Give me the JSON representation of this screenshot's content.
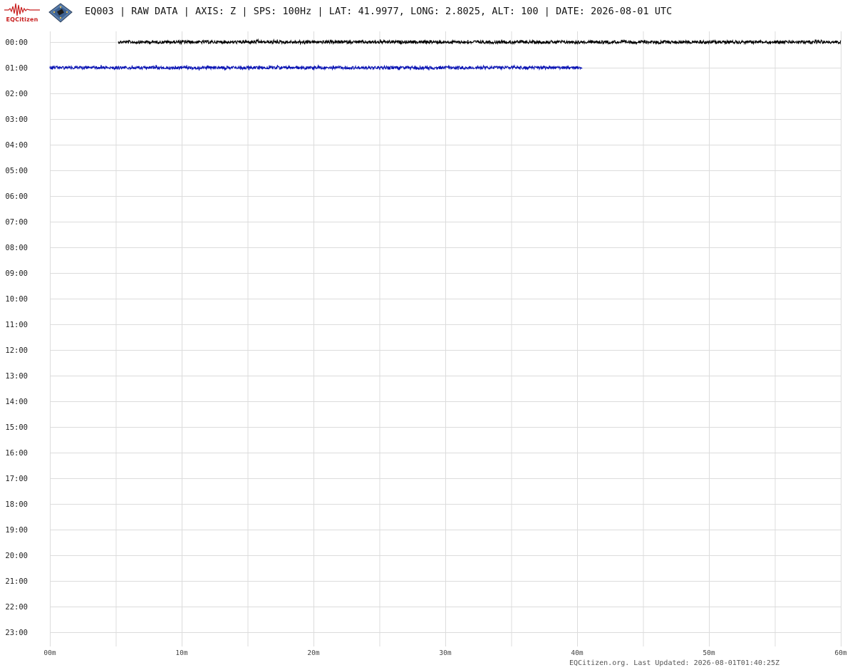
{
  "header": {
    "logo_text": "EQCitizen",
    "title": "EQ003 | RAW DATA | AXIS: Z | SPS: 100Hz | LAT: 41.9977, LONG: 2.8025, ALT: 100 | DATE: 2026-08-01 UTC"
  },
  "footer": {
    "text": "EQCitizen.org. Last Updated: 2026-08-01T01:40:25Z"
  },
  "colors": {
    "trace_even_hour": "#000000",
    "trace_odd_hour": "#0a14b4",
    "grid": "#dcdcdc",
    "logo": "#c81e1e"
  },
  "chart_data": {
    "type": "line",
    "title": "",
    "xlabel": "",
    "ylabel": "",
    "x_unit": "minutes",
    "xlim": [
      0,
      60
    ],
    "x_ticks": [
      "00m",
      "10m",
      "20m",
      "30m",
      "40m",
      "50m",
      "60m"
    ],
    "x_minor_grid_every": 5,
    "y_ticks": [
      "00:00",
      "01:00",
      "02:00",
      "03:00",
      "04:00",
      "05:00",
      "06:00",
      "07:00",
      "08:00",
      "09:00",
      "10:00",
      "11:00",
      "12:00",
      "13:00",
      "14:00",
      "15:00",
      "16:00",
      "17:00",
      "18:00",
      "19:00",
      "20:00",
      "21:00",
      "22:00",
      "23:00"
    ],
    "grid": true,
    "series": [
      {
        "hour": "00:00",
        "start_min": 5.2,
        "end_min": 60,
        "color": "#000000"
      },
      {
        "hour": "01:00",
        "start_min": 0,
        "end_min": 40.4,
        "color": "#0a14b4"
      }
    ]
  }
}
